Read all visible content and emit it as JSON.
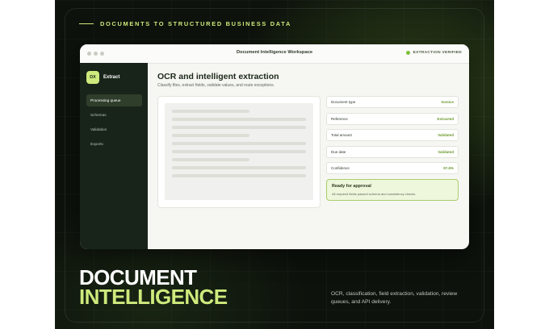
{
  "tagline": "DOCUMENTS TO STRUCTURED BUSINESS DATA",
  "window": {
    "title": "Document Intelligence Workspace",
    "status": "EXTRACTION VERIFIED"
  },
  "sidebar": {
    "logo_mark": "DX",
    "logo_name": "Extract",
    "items": [
      {
        "label": "Processing queue",
        "active": true
      },
      {
        "label": "Schemas"
      },
      {
        "label": "Validation"
      },
      {
        "label": "Exports"
      }
    ]
  },
  "main": {
    "title": "OCR and intelligent extraction",
    "subtitle": "Classify files, extract fields, validate values, and route exceptions.",
    "fields": [
      {
        "label": "Document type",
        "value": "Invoice"
      },
      {
        "label": "Reference",
        "value": "Extracted"
      },
      {
        "label": "Total amount",
        "value": "Validated"
      },
      {
        "label": "Due date",
        "value": "Validated"
      },
      {
        "label": "Confidence",
        "value": "97.6%"
      }
    ],
    "approval": {
      "title": "Ready for approval",
      "detail": "All required fields passed schema and consistency checks."
    }
  },
  "headline": {
    "line1": "DOCUMENT",
    "line2": "INTELLIGENCE"
  },
  "summary": "OCR, classification, field extraction, validation, review queues, and API delivery.",
  "colors": {
    "accent": "#cdea7c",
    "background": "#0d120c",
    "sidebar": "#18241a",
    "status_green": "#6a9a2c"
  }
}
